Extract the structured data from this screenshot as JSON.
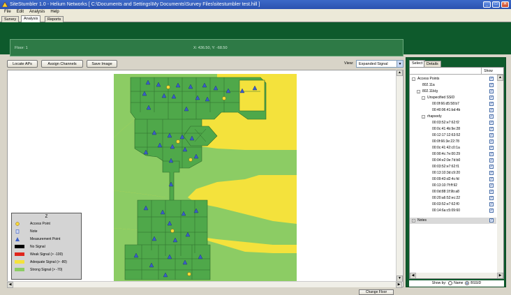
{
  "window": {
    "title": "SiteStumbler 1.0 - Helium Networks [ C:\\Documents and Settings\\My Documents\\Survey Files\\sitestumbler test.hill ]"
  },
  "menu": [
    "File",
    "Edit",
    "Analysis",
    "Help"
  ],
  "tabs": [
    {
      "label": "Survey",
      "active": false
    },
    {
      "label": "Analysis",
      "active": true
    },
    {
      "label": "Reports",
      "active": false
    }
  ],
  "info": {
    "floor": "Floor: 1",
    "coords": "X: 436.50, Y: -68.50"
  },
  "toolbar": {
    "locate": "Locate APs",
    "assign": "Assign Channels",
    "save": "Save Image",
    "view_label": "View:",
    "view_value": "Expanded Signal"
  },
  "legend": {
    "header": "Z",
    "items": [
      {
        "label": "Access Point",
        "kind": "ap"
      },
      {
        "label": "Note",
        "kind": "note"
      },
      {
        "label": "Measurement Point",
        "kind": "mp"
      },
      {
        "label": "No Signal",
        "kind": "swatch",
        "color": "#000000"
      },
      {
        "label": "Weak Signal (> -100)",
        "kind": "swatch",
        "color": "#e0261c"
      },
      {
        "label": "Adequate Signal (> -80)",
        "kind": "swatch",
        "color": "#f4e23c"
      },
      {
        "label": "Strong Signal (> -70)",
        "kind": "swatch",
        "color": "#8ccc64"
      }
    ]
  },
  "change_floor": "Change Floor",
  "right_panel": {
    "tabs": [
      {
        "label": "Select",
        "active": true
      },
      {
        "label": "Details",
        "active": false
      }
    ],
    "show_header": "Show",
    "tree": [
      {
        "label": "Access Points",
        "level": 0,
        "expander": "-"
      },
      {
        "label": "802.11a",
        "level": 1,
        "expander": ""
      },
      {
        "label": "802.11b/g",
        "level": 1,
        "expander": "-"
      },
      {
        "label": "Unspecified SSID",
        "level": 2,
        "expander": "-"
      },
      {
        "label": "00:0f:66:d5:58:b7",
        "level": 3,
        "expander": ""
      },
      {
        "label": "00:40:96:41:bd:4b",
        "level": 3,
        "expander": ""
      },
      {
        "label": "rhapsody",
        "level": 2,
        "expander": "-"
      },
      {
        "label": "00:03:52:e7:62:f2",
        "level": 3,
        "expander": ""
      },
      {
        "label": "00:0c:41:4b:9e:28",
        "level": 3,
        "expander": ""
      },
      {
        "label": "00:12:17:12:63:52",
        "level": 3,
        "expander": ""
      },
      {
        "label": "00:0f:66:3e:22:78",
        "level": 3,
        "expander": ""
      },
      {
        "label": "00:0c:41:42:c0:1a",
        "level": 3,
        "expander": ""
      },
      {
        "label": "00:90:4c:7e:00:29",
        "level": 3,
        "expander": ""
      },
      {
        "label": "00:04:e2:0e:7d:b0",
        "level": 3,
        "expander": ""
      },
      {
        "label": "00:03:52:e7:62:f1",
        "level": 3,
        "expander": ""
      },
      {
        "label": "00:13:10:3d:c9:20",
        "level": 3,
        "expander": ""
      },
      {
        "label": "00:09:43:d2:4c:fd",
        "level": 3,
        "expander": ""
      },
      {
        "label": "00:13:10:7f:ff:92",
        "level": 3,
        "expander": ""
      },
      {
        "label": "00:0d:88:1f:9b:a8",
        "level": 3,
        "expander": ""
      },
      {
        "label": "00:20:a6:52:ec:22",
        "level": 3,
        "expander": ""
      },
      {
        "label": "00:03:52:e7:62:f0",
        "level": 3,
        "expander": ""
      },
      {
        "label": "00:14:6a:c5:09:60",
        "level": 3,
        "expander": ""
      }
    ],
    "notes_label": "Notes",
    "show_by_label": "Show by:",
    "show_by_name": "Name",
    "show_by_bssid": "BSSID",
    "show_by_selected": "BSSID"
  },
  "colors": {
    "dark_green": "#0e5a2c",
    "strong_signal": "#8ccc64",
    "adequate_signal": "#f4e23c",
    "building_signal": "#4fa84a"
  }
}
